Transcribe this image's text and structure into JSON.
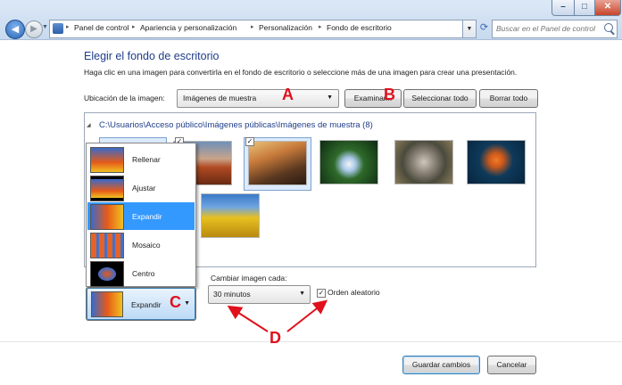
{
  "window": {
    "breadcrumbs": [
      "Panel de control",
      "Apariencia y personalización",
      "Personalización",
      "Fondo de escritorio"
    ],
    "search_placeholder": "Buscar en el Panel de control",
    "controls": {
      "minimize": "–",
      "maximize": "□",
      "close": "✕"
    }
  },
  "main": {
    "heading": "Elegir el fondo de escritorio",
    "description": "Haga clic en una imagen para convertirla en el fondo de escritorio o seleccione más de una imagen para crear una presentación.",
    "location_label": "Ubicación de la imagen:",
    "location_value": "Imágenes de muestra",
    "browse_button": "Examinar...",
    "select_all_button": "Seleccionar todo",
    "clear_all_button": "Borrar todo",
    "folder_path": "C:\\Usuarios\\Acceso público\\Imágenes públicas\\Imágenes de muestra (8)"
  },
  "position_menu": {
    "options": [
      "Rellenar",
      "Ajustar",
      "Expandir",
      "Mosaico",
      "Centro"
    ],
    "selected": "Expandir"
  },
  "slideshow": {
    "interval_label": "Cambiar imagen cada:",
    "interval_value": "30 minutos",
    "shuffle_label": "Orden aleatorio",
    "shuffle_checked": true
  },
  "footer": {
    "save_button": "Guardar cambios",
    "cancel_button": "Cancelar"
  },
  "annotations": {
    "a": "A",
    "b": "B",
    "c": "C",
    "d": "D"
  },
  "colors": {
    "accent_red": "#e0101c",
    "heading_blue": "#1f3d8a",
    "selection_blue": "#3399ff"
  }
}
